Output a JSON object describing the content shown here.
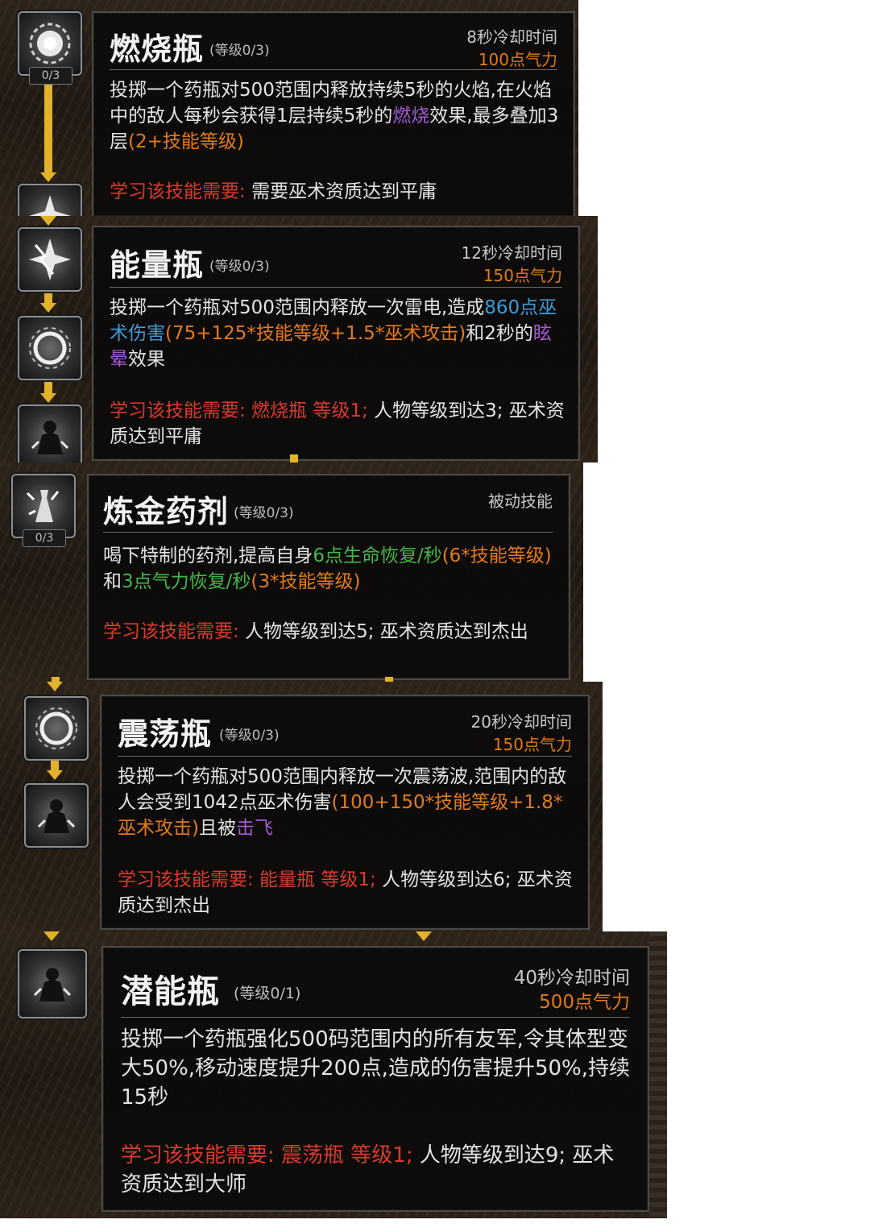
{
  "skills": [
    {
      "name": "燃烧瓶",
      "level": "(等级0/3)",
      "cooldown": "8秒冷却时间",
      "cost": "100点气力",
      "node_count": "0/3",
      "desc": [
        {
          "t": "投掷一个药瓶对500范围内释放持续5秒的火焰,在火焰中的敌人每秒会获得1层持续5秒的",
          "c": "white"
        },
        {
          "t": "燃烧",
          "c": "purple"
        },
        {
          "t": "效果,最多叠加3层",
          "c": "white"
        },
        {
          "t": "(2+技能等级)",
          "c": "orange"
        }
      ],
      "req": [
        {
          "t": "学习该技能需要: ",
          "c": "red"
        },
        {
          "t": "需要巫术资质达到平庸",
          "c": "white"
        }
      ]
    },
    {
      "name": "能量瓶",
      "level": "(等级0/3)",
      "cooldown": "12秒冷却时间",
      "cost": "150点气力",
      "desc": [
        {
          "t": "投掷一个药瓶对500范围内释放一次雷电,造成",
          "c": "white"
        },
        {
          "t": "860点巫术伤害",
          "c": "blue"
        },
        {
          "t": "(75+125*技能等级+1.5*巫术攻击)",
          "c": "orange"
        },
        {
          "t": "和2秒的",
          "c": "white"
        },
        {
          "t": "眩晕",
          "c": "purple"
        },
        {
          "t": "效果",
          "c": "white"
        }
      ],
      "req": [
        {
          "t": "学习该技能需要: 燃烧瓶 等级1; ",
          "c": "red"
        },
        {
          "t": "人物等级到达3; 巫术资质达到平庸",
          "c": "white"
        }
      ]
    },
    {
      "name": "炼金药剂",
      "level": "(等级0/3)",
      "passive": "被动技能",
      "node_count": "0/3",
      "desc": [
        {
          "t": "喝下特制的药剂,提高自身",
          "c": "white"
        },
        {
          "t": "6点生命恢复/秒",
          "c": "green"
        },
        {
          "t": "(6*技能等级)",
          "c": "orange"
        },
        {
          "t": "和",
          "c": "white"
        },
        {
          "t": "3点气力恢复/秒",
          "c": "green"
        },
        {
          "t": "(3*技能等级)",
          "c": "orange"
        }
      ],
      "req": [
        {
          "t": "学习该技能需要: ",
          "c": "red"
        },
        {
          "t": "人物等级到达5; 巫术资质达到杰出",
          "c": "white"
        }
      ]
    },
    {
      "name": "震荡瓶",
      "level": "(等级0/3)",
      "cooldown": "20秒冷却时间",
      "cost": "150点气力",
      "desc": [
        {
          "t": "投掷一个药瓶对500范围内释放一次震荡波,范围内的敌人会受到1042点巫术伤害",
          "c": "white"
        },
        {
          "t": "(100+150*技能等级+1.8*巫术攻击)",
          "c": "orange"
        },
        {
          "t": "且被",
          "c": "white"
        },
        {
          "t": "击飞",
          "c": "purple"
        }
      ],
      "req": [
        {
          "t": "学习该技能需要: 能量瓶 等级1; ",
          "c": "red"
        },
        {
          "t": "人物等级到达6; 巫术资质达到杰出",
          "c": "white"
        }
      ]
    },
    {
      "name": "潜能瓶",
      "level": "(等级0/1)",
      "cooldown": "40秒冷却时间",
      "cost": "500点气力",
      "desc": [
        {
          "t": "投掷一个药瓶强化500码范围内的所有友军,令其体型变大50%,移动速度提升200点,造成的伤害提升50%,持续15秒",
          "c": "white"
        }
      ],
      "req": [
        {
          "t": "学习该技能需要: 震荡瓶 等级1; ",
          "c": "red"
        },
        {
          "t": "人物等级到达9; 巫术资质达到大师",
          "c": "white"
        }
      ]
    }
  ],
  "icons": [
    "fire-burst-icon",
    "lightning-burst-icon",
    "shock-ring-icon",
    "spirit-figure-icon",
    "potion-splash-icon"
  ],
  "colors": {
    "accent_gold": "#e2b22a",
    "cost_orange": "#e07a18",
    "req_red": "#d93a2e",
    "formula_orange": "#e47a1c",
    "status_purple": "#a45ad6",
    "damage_blue": "#3d9bd8",
    "regen_green": "#42b74a"
  }
}
